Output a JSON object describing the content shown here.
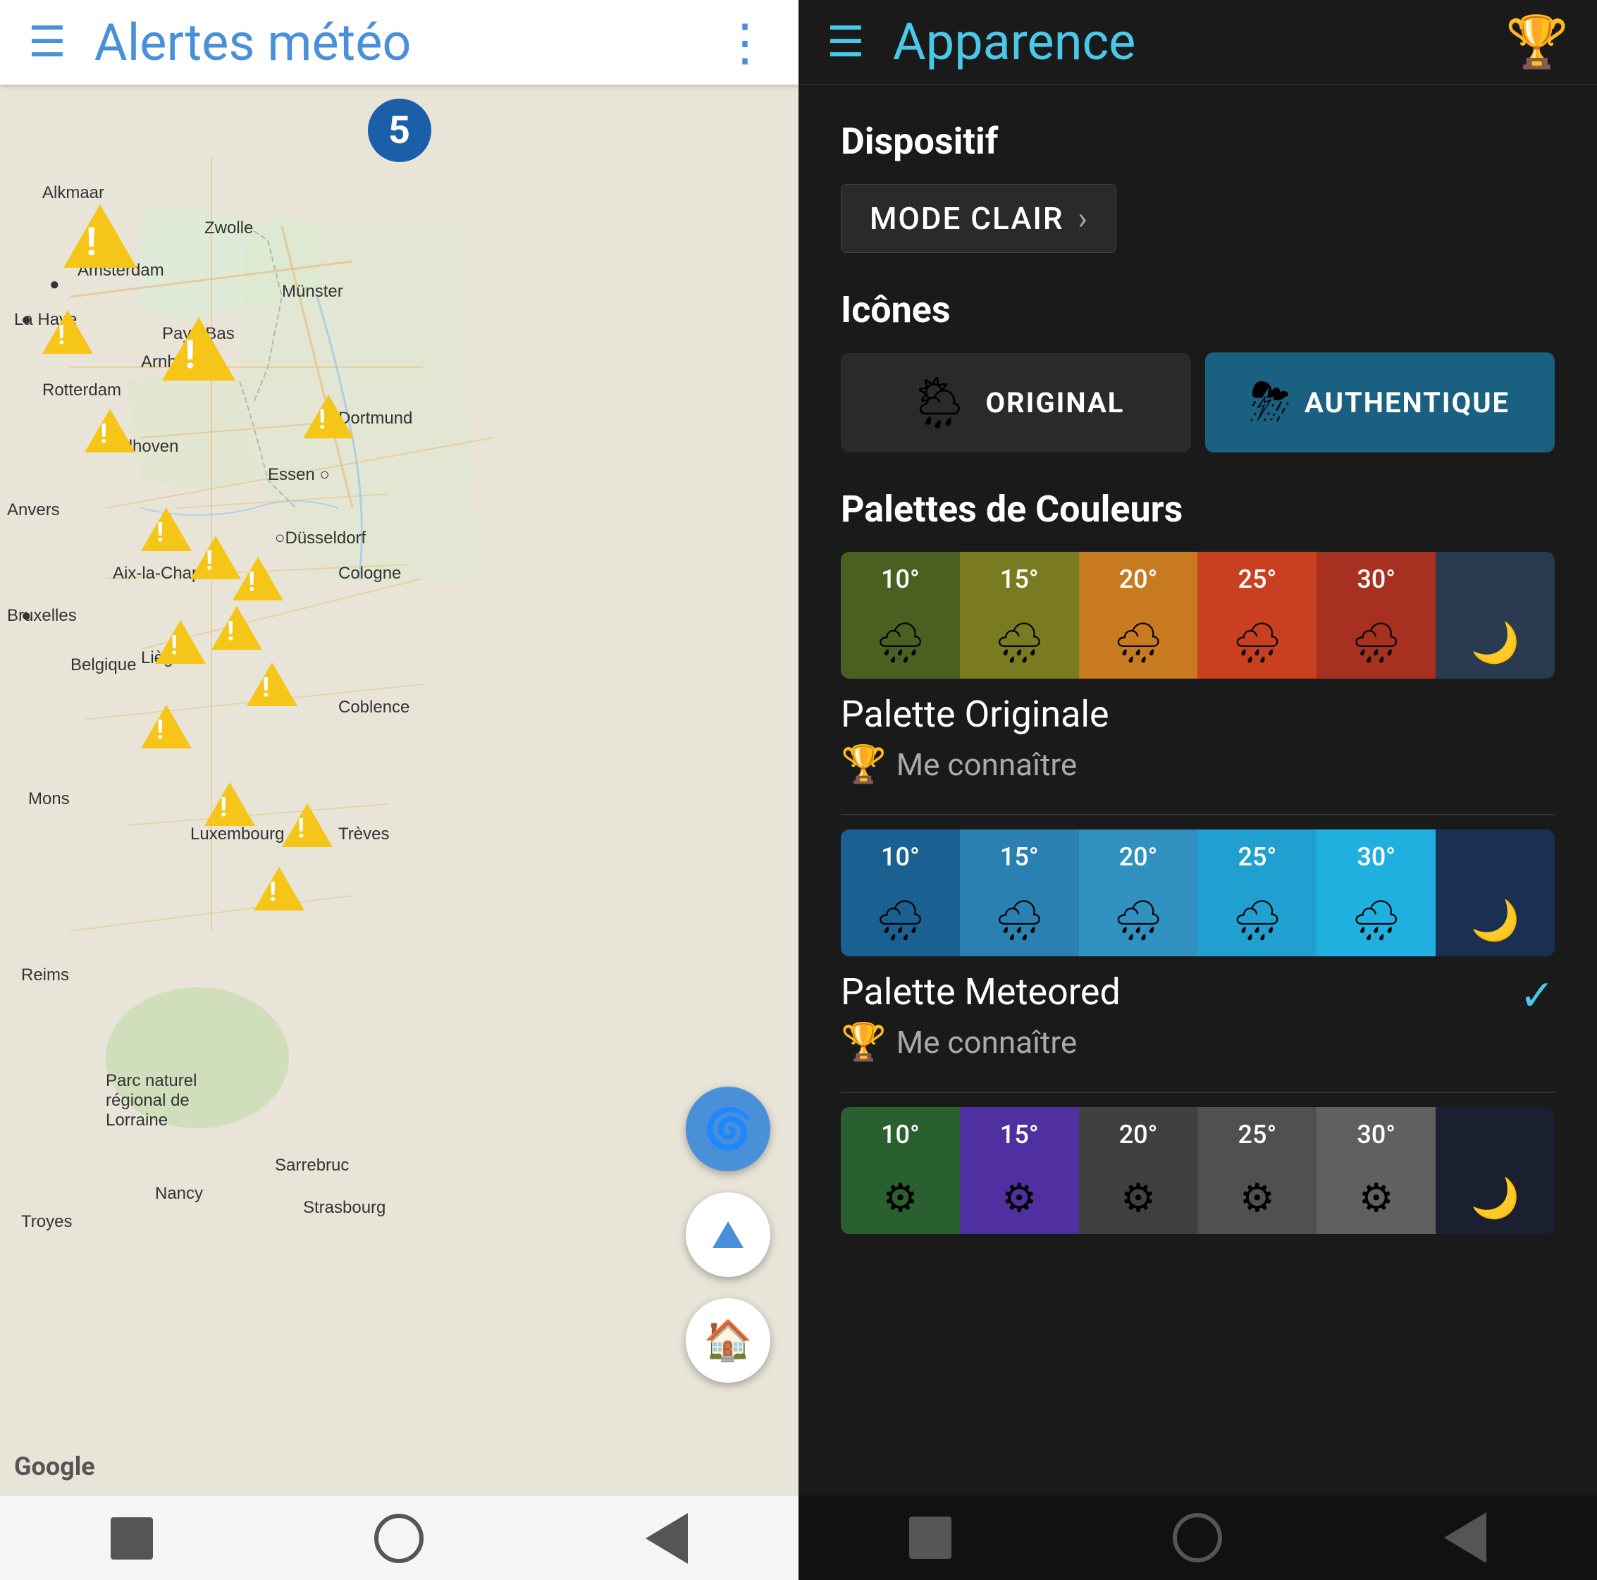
{
  "left": {
    "header": {
      "title": "Alertes météo",
      "hamburger": "☰",
      "more": "⋮"
    },
    "map": {
      "badge_count": "5",
      "google_label": "Google"
    },
    "fab": {
      "hurricane_icon": "🌀",
      "mountain_icon": "⛰",
      "home_icon": "🏠"
    },
    "bottom_nav": {
      "square": "■",
      "circle": "○",
      "back": "◀"
    }
  },
  "right": {
    "header": {
      "title": "Apparence",
      "hamburger": "☰",
      "trophy": "🏆"
    },
    "device_section": {
      "label": "Dispositif",
      "mode_button": "MODE CLAIR",
      "chevron": "›"
    },
    "icons_section": {
      "label": "Icônes",
      "original_label": "ORIGINAL",
      "authentic_label": "AUTHENTIQUE",
      "weather_icon_1": "🌦",
      "weather_icon_2": "⛈"
    },
    "palettes_section": {
      "label": "Palettes de Couleurs",
      "palette_original": {
        "name": "Palette Originale",
        "unlock_text": "Me connaître",
        "temps": [
          "10°",
          "15°",
          "20°",
          "25°",
          "30°"
        ],
        "night": "🌙"
      },
      "palette_meteored": {
        "name": "Palette Meteored",
        "unlock_text": "Me connaître",
        "temps": [
          "10°",
          "15°",
          "20°",
          "25°",
          "30°"
        ],
        "night": "🌙",
        "selected": true
      },
      "palette_third": {
        "temps": [
          "10°",
          "15°",
          "20°",
          "25°",
          "30°"
        ],
        "night": "🌙"
      }
    },
    "bottom_nav": {
      "square": "■",
      "circle": "○",
      "back": "◀"
    }
  }
}
